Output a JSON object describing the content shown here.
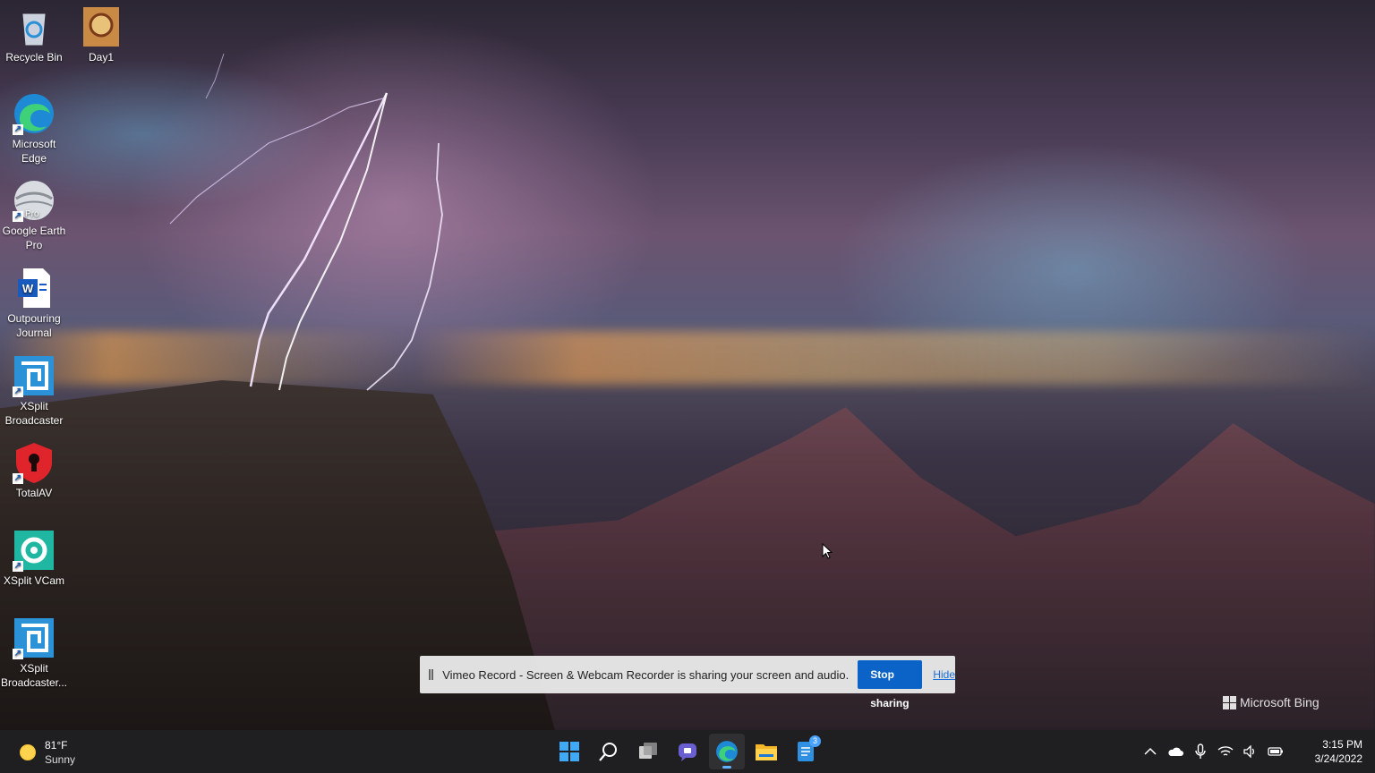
{
  "desktop": {
    "icons": [
      {
        "label": "Recycle Bin"
      },
      {
        "label": "Day1"
      },
      {
        "label": "Microsoft Edge"
      },
      {
        "label": "Google Earth Pro",
        "badge": "Pro"
      },
      {
        "label": "Outpouring Journal"
      },
      {
        "label": "XSplit Broadcaster"
      },
      {
        "label": "TotalAV"
      },
      {
        "label": "XSplit VCam"
      },
      {
        "label": "XSplit Broadcaster..."
      }
    ]
  },
  "share_banner": {
    "message": "Vimeo Record - Screen & Webcam Recorder is sharing your screen and audio.",
    "stop_label": "Stop sharing",
    "hide_label": "Hide"
  },
  "watermark": {
    "text": "Microsoft Bing"
  },
  "taskbar": {
    "weather": {
      "temp": "81°F",
      "condition": "Sunny"
    },
    "apps": [
      {
        "name": "start-icon"
      },
      {
        "name": "search-icon"
      },
      {
        "name": "task-view-icon"
      },
      {
        "name": "teams-chat-icon"
      },
      {
        "name": "edge-icon",
        "active": true
      },
      {
        "name": "file-explorer-icon"
      },
      {
        "name": "notepad-icon",
        "badge": "3"
      }
    ],
    "tray": [
      "chevron-up-icon",
      "onedrive-cloud-icon",
      "microphone-icon",
      "wifi-icon",
      "speaker-icon",
      "battery-icon"
    ],
    "clock": {
      "time": "3:15 PM",
      "date": "3/24/2022"
    }
  },
  "colors": {
    "taskbar_bg": "#1f1f22",
    "accent": "#0b63c7",
    "link": "#1a6fd6"
  }
}
